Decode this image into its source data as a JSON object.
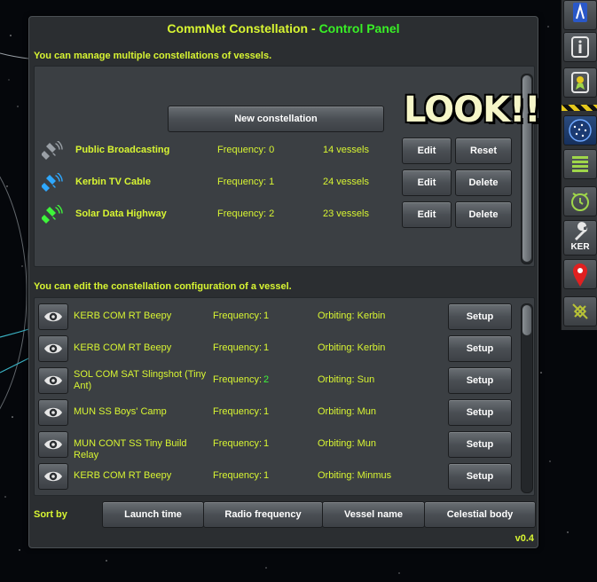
{
  "window": {
    "title_part1": "CommNet Constellation",
    "title_sep": " - ",
    "title_part2": "Control Panel",
    "info_constellations": "You can manage multiple constellations of vessels.",
    "info_vessels": "You can edit the constellation configuration of a vessel.",
    "overlay_text": "LOOK!!",
    "version": "v0.4"
  },
  "constellations": {
    "new_button": "New constellation",
    "rows": [
      {
        "name": "Public Broadcasting",
        "frequency": "Frequency: 0",
        "vessels": "14 vessels",
        "edit": "Edit",
        "action": "Reset",
        "icon_color": "#9aa0a6"
      },
      {
        "name": "Kerbin TV Cable",
        "frequency": "Frequency: 1",
        "vessels": "24 vessels",
        "edit": "Edit",
        "action": "Delete",
        "icon_color": "#2ea8ff"
      },
      {
        "name": "Solar Data Highway",
        "frequency": "Frequency: 2",
        "vessels": "23 vessels",
        "edit": "Edit",
        "action": "Delete",
        "icon_color": "#3ef53a"
      }
    ]
  },
  "vessels": {
    "freq_label": "Frequency:",
    "rows": [
      {
        "name": "KERB COM RT Beepy",
        "freq": "1",
        "orbit": "Orbiting: Kerbin",
        "setup": "Setup",
        "freq_color": "blue"
      },
      {
        "name": "KERB COM RT Beepy",
        "freq": "1",
        "orbit": "Orbiting: Kerbin",
        "setup": "Setup",
        "freq_color": "blue"
      },
      {
        "name": "SOL COM SAT Slingshot (Tiny Ant)",
        "freq": "2",
        "orbit": "Orbiting: Sun",
        "setup": "Setup",
        "freq_color": "green"
      },
      {
        "name": "MUN SS Boys' Camp",
        "freq": "1",
        "orbit": "Orbiting: Mun",
        "setup": "Setup",
        "freq_color": "blue"
      },
      {
        "name": "MUN CONT SS Tiny Build Relay",
        "freq": "1",
        "orbit": "Orbiting: Mun",
        "setup": "Setup",
        "freq_color": "blue"
      },
      {
        "name": "KERB COM RT Beepy",
        "freq": "1",
        "orbit": "Orbiting: Minmus",
        "setup": "Setup",
        "freq_color": "blue"
      }
    ]
  },
  "sort": {
    "label": "Sort by",
    "buttons": [
      "Launch time",
      "Radio frequency",
      "Vessel name",
      "Celestial body"
    ]
  },
  "toolbar": {
    "items": [
      {
        "icon": "map-icon"
      },
      {
        "icon": "info-icon"
      },
      {
        "icon": "reward-icon"
      },
      {
        "icon": "commnet-constellation-icon",
        "active": true
      },
      {
        "icon": "list-icon"
      },
      {
        "icon": "alarm-clock-icon"
      },
      {
        "icon": "wrench-icon",
        "label": "KER"
      },
      {
        "icon": "map-pin-icon"
      },
      {
        "icon": "satellite-icon"
      }
    ]
  }
}
